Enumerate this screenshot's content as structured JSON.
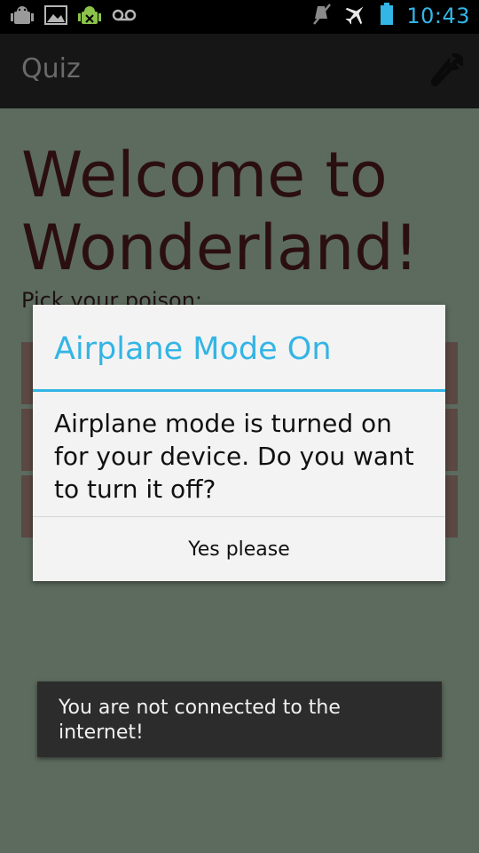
{
  "status_bar": {
    "time": "10:43",
    "left_icons": [
      "android-debug-icon",
      "image-icon",
      "android-usb-icon",
      "voicemail-icon"
    ],
    "right_icons": [
      "mute-icon",
      "airplane-icon",
      "battery-icon"
    ],
    "accent_color": "#33b5e5"
  },
  "action_bar": {
    "title": "Quiz",
    "settings_icon": "wrench-icon"
  },
  "main": {
    "welcome": "Welcome to Wonderland!",
    "prompt": "Pick your poison:",
    "options_count_visible": 3
  },
  "dialog": {
    "title": "Airplane Mode On",
    "message": "Airplane mode is turned on for your device. Do you want to turn it off?",
    "button_label": "Yes please"
  },
  "toast": {
    "text": "You are not connected to the internet!"
  },
  "colors": {
    "background": "#5c6b5e",
    "welcome_text": "#2b0f10",
    "option_bg": "#5b4843",
    "dialog_bg": "#f3f3f3",
    "toast_bg": "#2c2c2c"
  }
}
